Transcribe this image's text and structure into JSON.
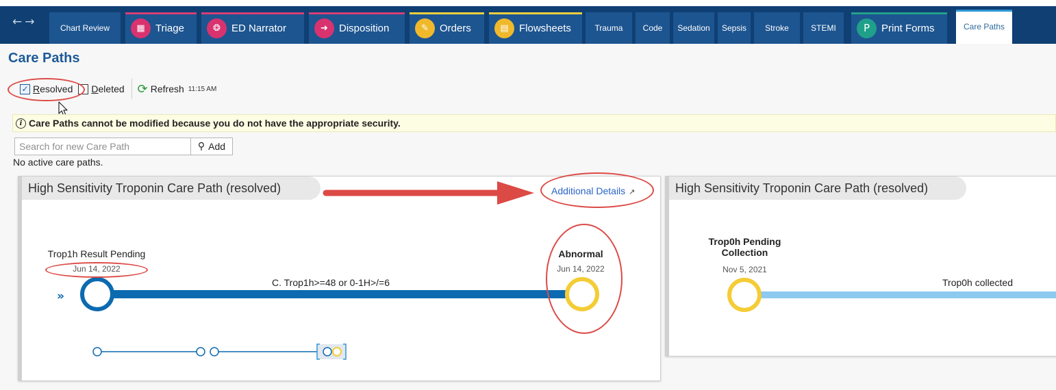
{
  "tabs": [
    {
      "label": "Chart Review",
      "icon": "",
      "accent": "#1d5590",
      "icon_color": ""
    },
    {
      "label": "Triage",
      "icon": "triage-icon",
      "accent": "#d83d74",
      "icon_color": "#d8336f"
    },
    {
      "label": "ED Narrator",
      "icon": "narrator-icon",
      "accent": "#d83d74",
      "icon_color": "#d8336f"
    },
    {
      "label": "Disposition",
      "icon": "disposition-icon",
      "accent": "#d83d74",
      "icon_color": "#d8336f"
    },
    {
      "label": "Orders",
      "icon": "orders-icon",
      "accent": "#f4cf3c",
      "icon_color": "#f0b92c"
    },
    {
      "label": "Flowsheets",
      "icon": "flowsheets-icon",
      "accent": "#f4cf3c",
      "icon_color": "#f0b92c"
    },
    {
      "label": "Trauma",
      "icon": "",
      "accent": "#1d5590",
      "icon_color": ""
    },
    {
      "label": "Code",
      "icon": "",
      "accent": "#1d5590",
      "icon_color": ""
    },
    {
      "label": "Sedation",
      "icon": "",
      "accent": "#1d5590",
      "icon_color": ""
    },
    {
      "label": "Sepsis",
      "icon": "",
      "accent": "#1d5590",
      "icon_color": ""
    },
    {
      "label": "Stroke",
      "icon": "",
      "accent": "#1d5590",
      "icon_color": ""
    },
    {
      "label": "STEMI",
      "icon": "",
      "accent": "#1d5590",
      "icon_color": ""
    },
    {
      "label": "Print Forms",
      "icon": "P",
      "accent": "#22a08a",
      "icon_color": "#20a08a"
    },
    {
      "label": "Care Paths",
      "icon": "",
      "accent": "#2f95d6",
      "icon_color": ""
    }
  ],
  "page_title": "Care Paths",
  "toolbar": {
    "resolved_label": "Resolved",
    "resolved_checked": true,
    "deleted_label": "Deleted",
    "deleted_checked": false,
    "refresh_label": "Refresh",
    "time": "11:15 AM"
  },
  "warning": "Care Paths cannot be modified because you do not have the appropriate security.",
  "search": {
    "placeholder": "Search for new Care Path",
    "add_label": "Add"
  },
  "no_active": "No active care paths.",
  "card1": {
    "title": "High Sensitivity Troponin Care Path (resolved)",
    "link": "Additional Details",
    "start_node": {
      "label": "Trop1h Result Pending",
      "date": "Jun 14, 2022"
    },
    "end_node": {
      "label": "Abnormal",
      "date": "Jun 14, 2022"
    },
    "edge_label": "C. Trop1h>=48 or 0-1H>/=6"
  },
  "card2": {
    "title": "High Sensitivity Troponin Care Path (resolved)",
    "start_node": {
      "label": "Trop0h Pending Collection",
      "date": "Nov 5, 2021"
    },
    "edge_label": "Trop0h collected"
  },
  "colors": {
    "accent_blue": "#0b6ab0",
    "node_yellow": "#f4cc36",
    "light_path": "#8ccaf0",
    "annotation_red": "#dc4a46",
    "link_blue": "#2a63c9"
  }
}
